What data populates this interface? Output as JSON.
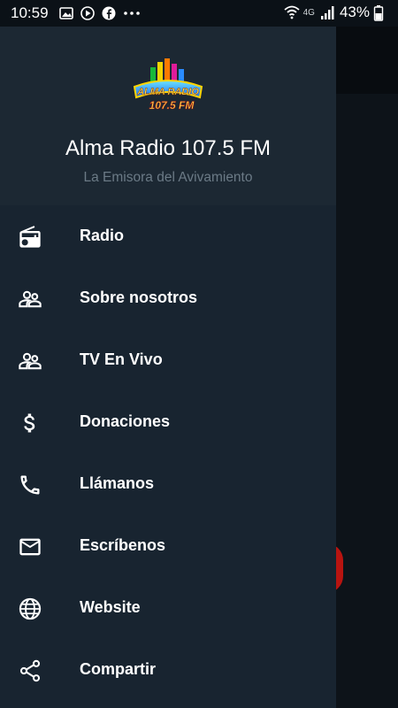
{
  "status_bar": {
    "time": "10:59",
    "network": "4G",
    "battery": "43%"
  },
  "drawer": {
    "title": "Alma Radio 107.5 FM",
    "subtitle": "La Emisora del Avivamiento",
    "logo": {
      "line1": "ALMA RADIO",
      "line2": "107.5 FM"
    },
    "items": [
      {
        "label": "Radio",
        "icon": "radio-icon"
      },
      {
        "label": "Sobre nosotros",
        "icon": "people-icon"
      },
      {
        "label": "TV En Vivo",
        "icon": "people-icon"
      },
      {
        "label": "Donaciones",
        "icon": "dollar-icon"
      },
      {
        "label": "Llámanos",
        "icon": "phone-icon"
      },
      {
        "label": "Escríbenos",
        "icon": "mail-icon"
      },
      {
        "label": "Website",
        "icon": "globe-icon"
      },
      {
        "label": "Compartir",
        "icon": "share-icon"
      }
    ]
  },
  "colors": {
    "drawer_bg": "#182430",
    "header_bg": "#1c2833",
    "subtitle": "#6b7a86",
    "fab": "#b81410"
  }
}
